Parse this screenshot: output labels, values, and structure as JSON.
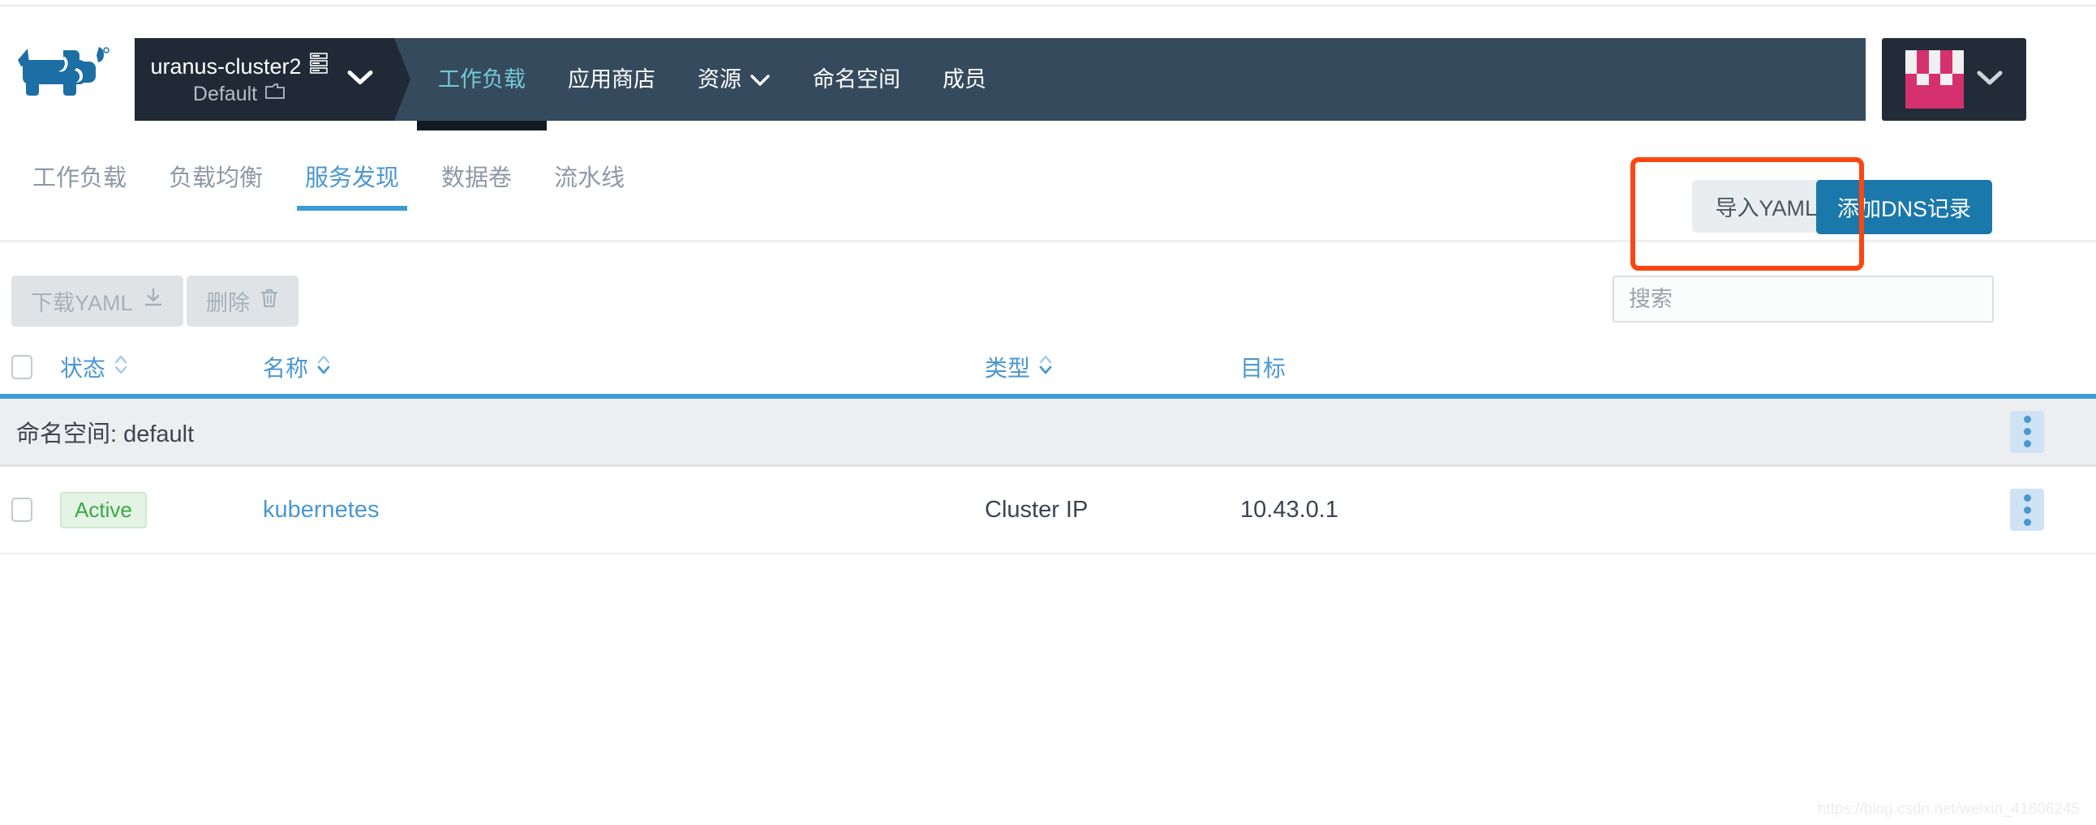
{
  "header": {
    "logo_icon": "rancher-cow-logo",
    "cluster": {
      "name": "uranus-cluster2",
      "cluster_icon": "server-stack-icon",
      "project": "Default",
      "project_icon": "folder-icon",
      "chevron_icon": "chevron-down-icon"
    },
    "nav": [
      {
        "label": "工作负载",
        "active": true,
        "caret": false
      },
      {
        "label": "应用商店",
        "active": false,
        "caret": false
      },
      {
        "label": "资源",
        "active": false,
        "caret": true
      },
      {
        "label": "命名空间",
        "active": false,
        "caret": false
      },
      {
        "label": "成员",
        "active": false,
        "caret": false
      }
    ],
    "user": {
      "avatar_icon": "user-identicon-avatar",
      "chevron_icon": "chevron-down-icon"
    }
  },
  "subtabs": [
    {
      "label": "工作负载",
      "active": false
    },
    {
      "label": "负载均衡",
      "active": false
    },
    {
      "label": "服务发现",
      "active": true
    },
    {
      "label": "数据卷",
      "active": false
    },
    {
      "label": "流水线",
      "active": false
    }
  ],
  "page_actions": {
    "import_yaml_label": "导入YAML",
    "add_dns_label": "添加DNS记录",
    "highlight_color": "#fc4612"
  },
  "toolbar": {
    "download_yaml_label": "下载YAML",
    "download_icon": "download-icon",
    "delete_label": "删除",
    "delete_icon": "trash-icon",
    "search_placeholder": "搜索",
    "search_value": ""
  },
  "table": {
    "columns": [
      {
        "label": "状态",
        "sortable": true
      },
      {
        "label": "名称",
        "sortable": true
      },
      {
        "label": "类型",
        "sortable": true
      },
      {
        "label": "目标",
        "sortable": false
      }
    ],
    "sort_icon": "sort-updown-icon",
    "menu_icon": "kebab-menu-icon",
    "groups": [
      {
        "label": "命名空间: default",
        "rows": [
          {
            "state": "Active",
            "name": "kubernetes",
            "type": "Cluster IP",
            "target": "10.43.0.1"
          }
        ]
      }
    ]
  },
  "watermark": "https://blog.csdn.net/weixin_41806245",
  "colors": {
    "cluster_panel": "#1f2a36",
    "navbar": "#364a5e",
    "nav_active": "#74c9d6",
    "accent_blue": "#4a97d2",
    "primary_button": "#1b78ab",
    "badge_green": "#3da64a",
    "avatar_pink": "#d6316f"
  }
}
